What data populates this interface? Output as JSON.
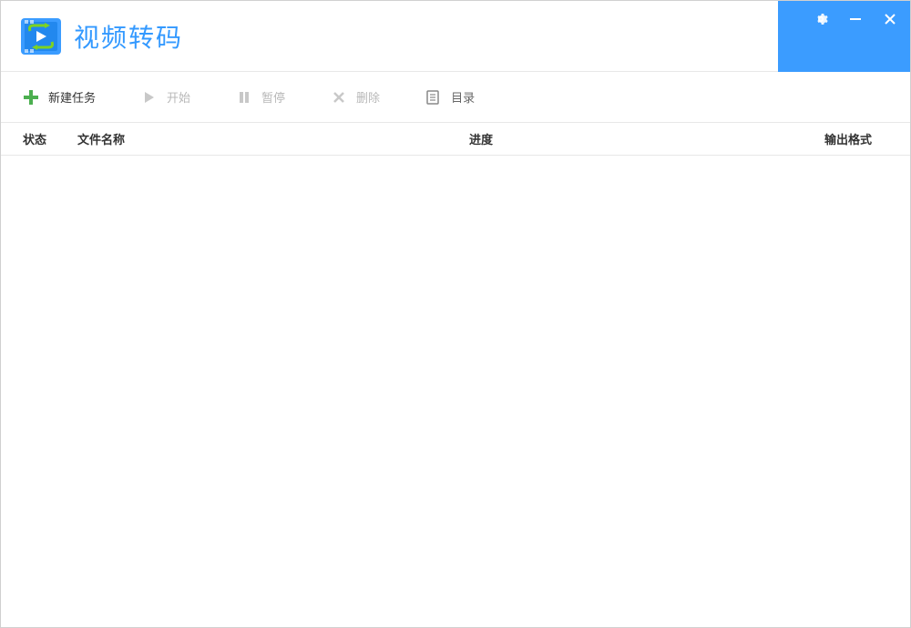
{
  "app": {
    "title": "视频转码"
  },
  "toolbar": {
    "new_task": "新建任务",
    "start": "开始",
    "pause": "暂停",
    "delete": "删除",
    "directory": "目录"
  },
  "table": {
    "headers": {
      "status": "状态",
      "filename": "文件名称",
      "progress": "进度",
      "output_format": "输出格式"
    },
    "rows": []
  }
}
